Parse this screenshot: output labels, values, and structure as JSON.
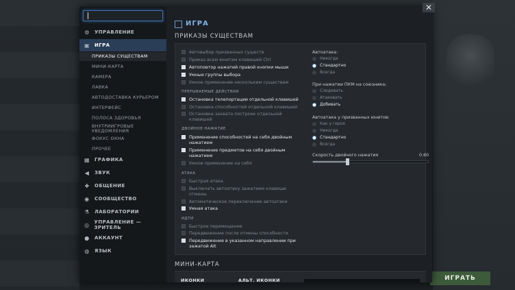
{
  "sidebar": {
    "search_value": "",
    "items": [
      {
        "label": "УПРАВЛЕНИЕ",
        "icon": "controls-icon",
        "glyph": "⚙"
      },
      {
        "label": "ИГРА",
        "icon": "game-icon",
        "glyph": "▣",
        "active": true
      },
      {
        "label": "ГРАФИКА",
        "icon": "graphics-icon",
        "glyph": "▦"
      },
      {
        "label": "ЗВУК",
        "icon": "sound-icon",
        "glyph": "◀"
      },
      {
        "label": "ОБЩЕНИЕ",
        "icon": "chat-icon",
        "glyph": "✚"
      },
      {
        "label": "СООБЩЕСТВО",
        "icon": "community-icon",
        "glyph": "◉"
      },
      {
        "label": "ЛАБОРАТОРИИ",
        "icon": "labs-icon",
        "glyph": "⚗"
      },
      {
        "label": "УПРАВЛЕНИЕ — ЗРИТЕЛЬ",
        "icon": "spectator-icon",
        "glyph": "◎"
      },
      {
        "label": "АККАУНТ",
        "icon": "account-icon",
        "glyph": "●"
      },
      {
        "label": "ЯЗЫК",
        "icon": "language-icon",
        "glyph": "◍"
      }
    ],
    "subitems": [
      {
        "label": "ПРИКАЗЫ СУЩЕСТВАМ",
        "active": true
      },
      {
        "label": "МИНИ-КАРТА"
      },
      {
        "label": "КАМЕРА"
      },
      {
        "label": "ЛАВКА"
      },
      {
        "label": "АВТОДОСТАВКА КУРЬЕРОМ"
      },
      {
        "label": "ИНТЕРФЕЙС"
      },
      {
        "label": "ПОЛОСА ЗДОРОВЬЯ"
      },
      {
        "label": "ВНУТРИИГРОВЫЕ УВЕДОМЛЕНИЯ"
      },
      {
        "label": "ФОКУС ОКНА"
      },
      {
        "label": "ПРОЧЕЕ"
      }
    ]
  },
  "header": {
    "title": "ИГРА",
    "section": "ПРИКАЗЫ СУЩЕСТВАМ"
  },
  "left_options": [
    {
      "label": "Автовыбор призванных существ",
      "checked": false
    },
    {
      "label": "Приказ всем юнитам клавишей Ctrl",
      "checked": false
    },
    {
      "label": "Автоповтор нажатий правой кнопки мыши",
      "checked": true
    },
    {
      "label": "Умные группы выбора",
      "checked": true
    },
    {
      "label": "Умное применение нескольким существам",
      "checked": false
    }
  ],
  "groups": {
    "interruptible": {
      "title": "Прерываемые действия",
      "options": [
        {
          "label": "Остановка телепортации отдельной клавишей",
          "checked": true
        },
        {
          "label": "Остановка способностей отдельной клавишей",
          "checked": false
        },
        {
          "label": "Остановка захвата построек отдельной клавишей",
          "checked": false
        }
      ]
    },
    "double_tap": {
      "title": "Двойное нажатие",
      "options": [
        {
          "label": "Применение способностей на себя двойным нажатием",
          "checked": true
        },
        {
          "label": "Применение предметов на себя двойным нажатием",
          "checked": true
        },
        {
          "label": "Умное применение на себя",
          "checked": false
        }
      ]
    },
    "attack": {
      "title": "Атака",
      "options": [
        {
          "label": "Быстрая атака",
          "checked": false
        },
        {
          "label": "Выключать автоатаку зажатием клавиши отмены",
          "checked": false
        },
        {
          "label": "Автоматическое переключение автоатаки",
          "checked": false
        },
        {
          "label": "Умная атака",
          "checked": true
        }
      ]
    },
    "move": {
      "title": "Идти",
      "options": [
        {
          "label": "Быстрое перемещение",
          "checked": false
        },
        {
          "label": "Передвижение после отмены способности",
          "checked": false
        },
        {
          "label": "Передвижение в указанном направлении при зажатой Alt",
          "checked": true
        }
      ]
    }
  },
  "radio_groups": {
    "autoattack": {
      "title": "Автоатака:",
      "options": [
        {
          "label": "Никогда",
          "selected": false
        },
        {
          "label": "Стандартно",
          "selected": true
        },
        {
          "label": "Всегда",
          "selected": false
        }
      ]
    },
    "rmb_ally": {
      "title": "При нажатии ПКМ на союзника:",
      "options": [
        {
          "label": "Следовать",
          "selected": false
        },
        {
          "label": "Атаковать",
          "selected": false
        },
        {
          "label": "Добивать",
          "selected": true
        }
      ]
    },
    "summoned_autoattack": {
      "title": "Автоатака у призванных юнитов:",
      "options": [
        {
          "label": "Как у героя",
          "selected": false
        },
        {
          "label": "Никогда",
          "selected": false
        },
        {
          "label": "Стандартно",
          "selected": true
        },
        {
          "label": "Всегда",
          "selected": false
        }
      ]
    }
  },
  "slider": {
    "label": "Скорость двойного нажатия",
    "value_text": "0.60",
    "value": 0.6,
    "min": 0.0,
    "max": 2.0
  },
  "minimap": {
    "title": "МИНИ-КАРТА",
    "col_icons": "ИКОНКИ",
    "col_alt_icons": "АЛЬТ. ИКОНКИ"
  },
  "play_label": "ИГРАТЬ",
  "close_glyph": "✕",
  "colors": {
    "accent": "#7fb0ea",
    "active_nav": "#2a3e58"
  }
}
